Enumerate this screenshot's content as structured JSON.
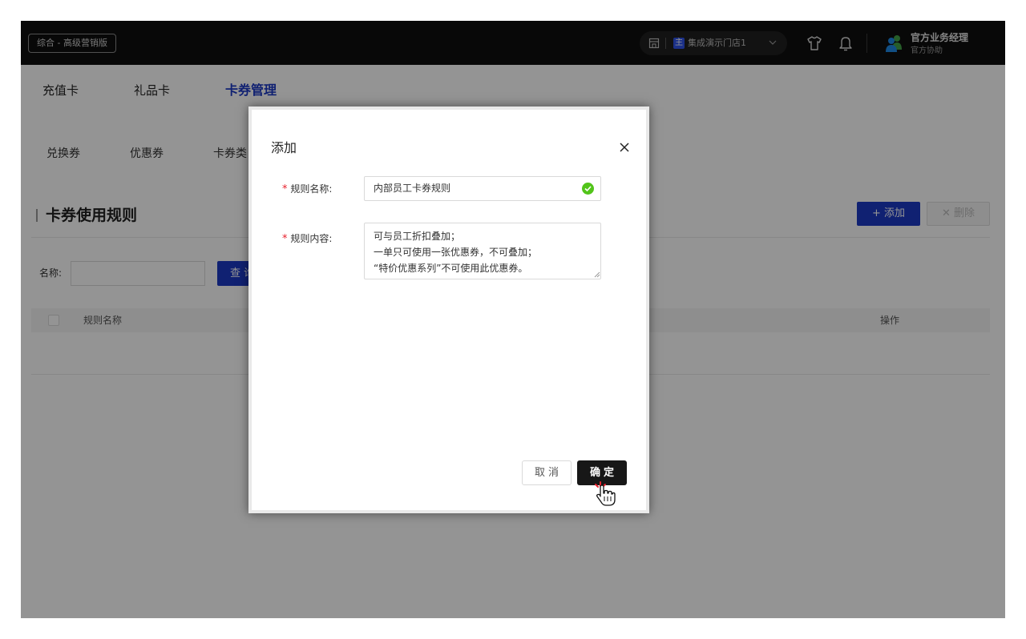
{
  "topbar": {
    "edition": "综合 - 高级营销版",
    "store_tag": "主",
    "store_name": "集成演示门店1",
    "user_name": "官方业务经理",
    "user_role": "官方协助"
  },
  "tabs": [
    "充值卡",
    "礼品卡",
    "卡券管理"
  ],
  "subtabs": [
    "兑换券",
    "优惠券",
    "卡券类"
  ],
  "section": {
    "title": "卡券使用规则",
    "add_label": "+ 添加",
    "delete_label": "✕ 删除"
  },
  "filter": {
    "name_label": "名称:",
    "query_label": "查 询"
  },
  "table": {
    "columns": [
      "规则名称",
      "操作"
    ]
  },
  "modal": {
    "title": "添加",
    "name_label": "规则名称:",
    "name_value": "内部员工卡券规则",
    "content_label": "规则内容:",
    "content_value": "可与员工折扣叠加；\n一单只可使用一张优惠券，不可叠加；\n“特价优惠系列”不可使用此优惠券。",
    "cancel_label": "取消",
    "confirm_label": "确定",
    "required_mark": "*"
  }
}
